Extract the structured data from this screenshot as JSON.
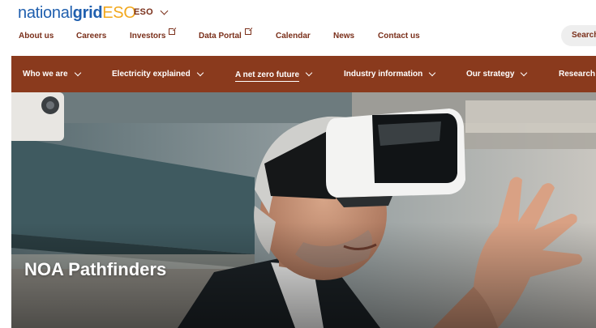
{
  "brand": {
    "logo_part1": "national",
    "logo_part2": "grid",
    "logo_part3": "ESO",
    "switcher_label": "ESO",
    "colors": {
      "primary_blue": "#1f5fae",
      "accent_yellow": "#f2a81d",
      "brand_rust": "#8a3a1d",
      "link_rust": "#7a2f1a"
    }
  },
  "utility_nav": {
    "items": [
      {
        "label": "About us",
        "icon": null
      },
      {
        "label": "Careers",
        "icon": null
      },
      {
        "label": "Investors",
        "icon": "external-link-icon"
      },
      {
        "label": "Data Portal",
        "icon": "external-link-icon"
      },
      {
        "label": "Calendar",
        "icon": null
      },
      {
        "label": "News",
        "icon": null
      },
      {
        "label": "Contact us",
        "icon": null
      }
    ]
  },
  "search": {
    "placeholder": "Search"
  },
  "main_nav": {
    "items": [
      {
        "label": "Who we are"
      },
      {
        "label": "Electricity explained"
      },
      {
        "label": "A net zero future",
        "active": true
      },
      {
        "label": "Industry information"
      },
      {
        "label": "Our strategy"
      },
      {
        "label": "Research"
      }
    ]
  },
  "hero": {
    "title": "NOA Pathfinders"
  }
}
